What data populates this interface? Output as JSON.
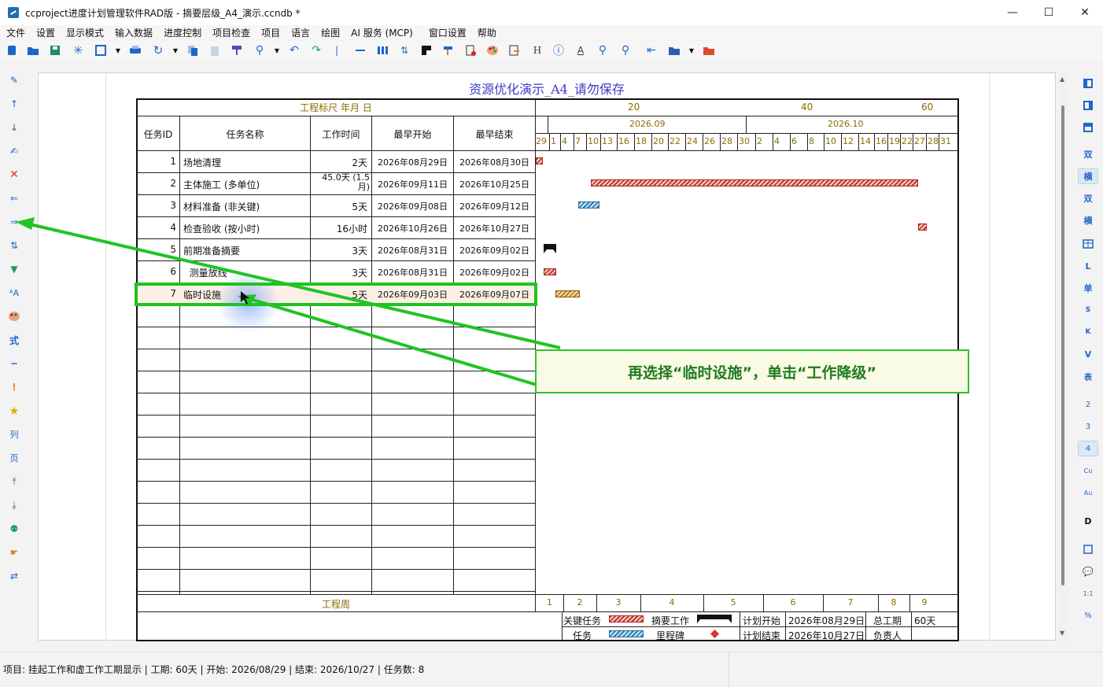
{
  "window": {
    "title": "ccproject进度计划管理软件RAD版 - 摘要层级_A4_演示.ccndb *",
    "minimize": "—",
    "maximize": "☐",
    "close": "✕"
  },
  "menu": [
    "文件",
    "设置",
    "显示模式",
    "输入数据",
    "进度控制",
    "项目检查",
    "项目",
    "语言",
    "绘图",
    "AI 服务 (MCP)",
    "窗口设置",
    "帮助"
  ],
  "toolbar_icons": [
    "new-file-icon",
    "open-folder-icon",
    "save-icon",
    "star-burst-icon",
    "image-export-icon",
    "dropdown-arrow-icon",
    "print-icon",
    "refresh-icon",
    "dropdown-arrow-icon",
    "copy-icon",
    "paste-icon",
    "format-painter-icon",
    "search-icon",
    "dropdown-arrow-icon",
    "undo-icon",
    "redo-icon",
    "separator-icon",
    "line-icon",
    "columns-icon",
    "sort-icon",
    "contrast-icon",
    "brush-icon",
    "report-icon",
    "palette-icon",
    "edit-note-icon",
    "heading-icon",
    "info-icon",
    "font-icon",
    "zoom-out-icon",
    "zoom-in-icon",
    "back-icon",
    "folder-icon",
    "dropdown-arrow-icon",
    "red-folder-icon"
  ],
  "toolbar_glyphs": {
    "heading": "H",
    "info": "ⓘ",
    "font": "A"
  },
  "left_tools": [
    "pencil-icon",
    "arrow-up-icon",
    "arrow-down-icon",
    "edit-icon",
    "delete-icon",
    "upgrade-icon",
    "downgrade-icon",
    "swap-icon",
    "filter-icon",
    "font-size-icon",
    "palette-icon",
    "formula-icon",
    "dotted-line-icon",
    "warning-icon",
    "star-icon",
    "column-icon",
    "page-icon",
    "move-top-icon",
    "move-bottom-icon",
    "users-icon",
    "hand-icon",
    "exchange-icon"
  ],
  "left_glyphs": {
    "formula": "式",
    "column": "列",
    "page": "页"
  },
  "right_tools": [
    "双",
    "横",
    "双",
    "横",
    "table",
    "L",
    "单",
    "S",
    "K",
    "V",
    "表",
    "2",
    "3",
    "4",
    "Cu",
    "Au",
    "D",
    "box",
    "chat",
    "1:1",
    "%"
  ],
  "doc_title": "资源优化演示_A4_请勿保存",
  "scale_label": "工程标尺 年月 日",
  "columns": [
    "任务ID",
    "任务名称",
    "工作时间",
    "最早开始",
    "最早结束"
  ],
  "rows": [
    {
      "id": "1",
      "name": "场地清理",
      "dur": "2天",
      "start": "2026年08月29日",
      "end": "2026年08月30日"
    },
    {
      "id": "2",
      "name": "主体施工 (多单位)",
      "dur": "45.0天 (1.5月)",
      "start": "2026年09月11日",
      "end": "2026年10月25日"
    },
    {
      "id": "3",
      "name": "材料准备 (非关键)",
      "dur": "5天",
      "start": "2026年09月08日",
      "end": "2026年09月12日"
    },
    {
      "id": "4",
      "name": "检查验收 (按小时)",
      "dur": "16小时",
      "start": "2026年10月26日",
      "end": "2026年10月27日"
    },
    {
      "id": "5",
      "name": "前期准备摘要",
      "dur": "3天",
      "start": "2026年08月31日",
      "end": "2026年09月02日"
    },
    {
      "id": "6",
      "name": "  测量放线",
      "dur": "3天",
      "start": "2026年08月31日",
      "end": "2026年09月02日"
    },
    {
      "id": "7",
      "name": "临时设施",
      "dur": "5天",
      "start": "2026年09月03日",
      "end": "2026年09月07日"
    }
  ],
  "timescale": {
    "top_numbers": [
      "20",
      "40",
      "60"
    ],
    "months": [
      "2026.09",
      "2026.10"
    ],
    "days": [
      "29",
      "1",
      "4",
      "7",
      "10",
      "13",
      "16",
      "18",
      "20",
      "22",
      "24",
      "26",
      "28",
      "30",
      "2",
      "4",
      "6",
      "8",
      "10",
      "12",
      "14",
      "16",
      "19",
      "22",
      "27",
      "28",
      "31"
    ]
  },
  "footer": {
    "week_label": "工程周",
    "weeks": [
      "1",
      "2",
      "3",
      "4",
      "5",
      "6",
      "7",
      "8",
      "9"
    ],
    "legend": {
      "critical": "关键任务",
      "summary": "摘要工作",
      "task": "任务",
      "milestone": "里程碑",
      "plan_start_label": "计划开始",
      "plan_start": "2026年08月29日",
      "plan_end_label": "计划结束",
      "plan_end": "2026年10月27日",
      "total_label": "总工期",
      "total": "60天",
      "owner_label": "负责人"
    }
  },
  "callout_text": "再选择“临时设施”，单击“工作降级”",
  "status": "项目: 挂起工作和虚工作工期显示 | 工期: 60天 | 开始: 2026/08/29 | 结束: 2026/10/27 | 任务数: 8",
  "colors": {
    "accent_green": "#22c322",
    "title_blue": "#3b3bc8",
    "critical_red": "#c0392b",
    "task_blue": "#2a7fb8"
  }
}
